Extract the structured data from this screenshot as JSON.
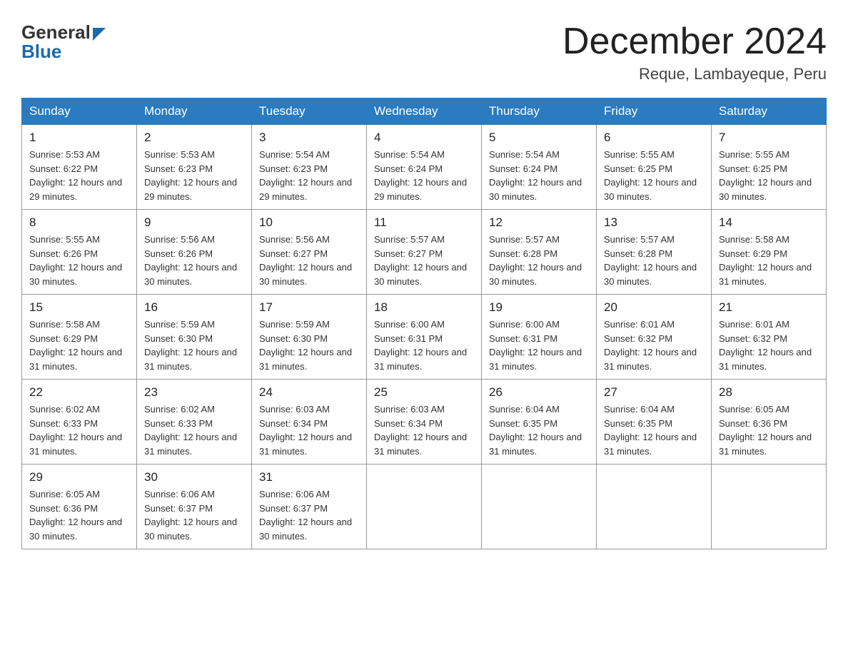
{
  "header": {
    "logo_general": "General",
    "logo_blue": "Blue",
    "month_title": "December 2024",
    "location": "Reque, Lambayeque, Peru"
  },
  "days_of_week": [
    "Sunday",
    "Monday",
    "Tuesday",
    "Wednesday",
    "Thursday",
    "Friday",
    "Saturday"
  ],
  "weeks": [
    [
      {
        "day": "1",
        "sunrise": "5:53 AM",
        "sunset": "6:22 PM",
        "daylight": "12 hours and 29 minutes."
      },
      {
        "day": "2",
        "sunrise": "5:53 AM",
        "sunset": "6:23 PM",
        "daylight": "12 hours and 29 minutes."
      },
      {
        "day": "3",
        "sunrise": "5:54 AM",
        "sunset": "6:23 PM",
        "daylight": "12 hours and 29 minutes."
      },
      {
        "day": "4",
        "sunrise": "5:54 AM",
        "sunset": "6:24 PM",
        "daylight": "12 hours and 29 minutes."
      },
      {
        "day": "5",
        "sunrise": "5:54 AM",
        "sunset": "6:24 PM",
        "daylight": "12 hours and 30 minutes."
      },
      {
        "day": "6",
        "sunrise": "5:55 AM",
        "sunset": "6:25 PM",
        "daylight": "12 hours and 30 minutes."
      },
      {
        "day": "7",
        "sunrise": "5:55 AM",
        "sunset": "6:25 PM",
        "daylight": "12 hours and 30 minutes."
      }
    ],
    [
      {
        "day": "8",
        "sunrise": "5:55 AM",
        "sunset": "6:26 PM",
        "daylight": "12 hours and 30 minutes."
      },
      {
        "day": "9",
        "sunrise": "5:56 AM",
        "sunset": "6:26 PM",
        "daylight": "12 hours and 30 minutes."
      },
      {
        "day": "10",
        "sunrise": "5:56 AM",
        "sunset": "6:27 PM",
        "daylight": "12 hours and 30 minutes."
      },
      {
        "day": "11",
        "sunrise": "5:57 AM",
        "sunset": "6:27 PM",
        "daylight": "12 hours and 30 minutes."
      },
      {
        "day": "12",
        "sunrise": "5:57 AM",
        "sunset": "6:28 PM",
        "daylight": "12 hours and 30 minutes."
      },
      {
        "day": "13",
        "sunrise": "5:57 AM",
        "sunset": "6:28 PM",
        "daylight": "12 hours and 30 minutes."
      },
      {
        "day": "14",
        "sunrise": "5:58 AM",
        "sunset": "6:29 PM",
        "daylight": "12 hours and 31 minutes."
      }
    ],
    [
      {
        "day": "15",
        "sunrise": "5:58 AM",
        "sunset": "6:29 PM",
        "daylight": "12 hours and 31 minutes."
      },
      {
        "day": "16",
        "sunrise": "5:59 AM",
        "sunset": "6:30 PM",
        "daylight": "12 hours and 31 minutes."
      },
      {
        "day": "17",
        "sunrise": "5:59 AM",
        "sunset": "6:30 PM",
        "daylight": "12 hours and 31 minutes."
      },
      {
        "day": "18",
        "sunrise": "6:00 AM",
        "sunset": "6:31 PM",
        "daylight": "12 hours and 31 minutes."
      },
      {
        "day": "19",
        "sunrise": "6:00 AM",
        "sunset": "6:31 PM",
        "daylight": "12 hours and 31 minutes."
      },
      {
        "day": "20",
        "sunrise": "6:01 AM",
        "sunset": "6:32 PM",
        "daylight": "12 hours and 31 minutes."
      },
      {
        "day": "21",
        "sunrise": "6:01 AM",
        "sunset": "6:32 PM",
        "daylight": "12 hours and 31 minutes."
      }
    ],
    [
      {
        "day": "22",
        "sunrise": "6:02 AM",
        "sunset": "6:33 PM",
        "daylight": "12 hours and 31 minutes."
      },
      {
        "day": "23",
        "sunrise": "6:02 AM",
        "sunset": "6:33 PM",
        "daylight": "12 hours and 31 minutes."
      },
      {
        "day": "24",
        "sunrise": "6:03 AM",
        "sunset": "6:34 PM",
        "daylight": "12 hours and 31 minutes."
      },
      {
        "day": "25",
        "sunrise": "6:03 AM",
        "sunset": "6:34 PM",
        "daylight": "12 hours and 31 minutes."
      },
      {
        "day": "26",
        "sunrise": "6:04 AM",
        "sunset": "6:35 PM",
        "daylight": "12 hours and 31 minutes."
      },
      {
        "day": "27",
        "sunrise": "6:04 AM",
        "sunset": "6:35 PM",
        "daylight": "12 hours and 31 minutes."
      },
      {
        "day": "28",
        "sunrise": "6:05 AM",
        "sunset": "6:36 PM",
        "daylight": "12 hours and 31 minutes."
      }
    ],
    [
      {
        "day": "29",
        "sunrise": "6:05 AM",
        "sunset": "6:36 PM",
        "daylight": "12 hours and 30 minutes."
      },
      {
        "day": "30",
        "sunrise": "6:06 AM",
        "sunset": "6:37 PM",
        "daylight": "12 hours and 30 minutes."
      },
      {
        "day": "31",
        "sunrise": "6:06 AM",
        "sunset": "6:37 PM",
        "daylight": "12 hours and 30 minutes."
      },
      null,
      null,
      null,
      null
    ]
  ],
  "labels": {
    "sunrise_prefix": "Sunrise: ",
    "sunset_prefix": "Sunset: ",
    "daylight_prefix": "Daylight: "
  }
}
